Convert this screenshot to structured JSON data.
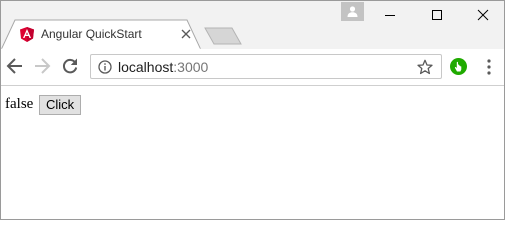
{
  "browser": {
    "tab": {
      "title": "Angular QuickStart",
      "favicon": "angular-icon"
    },
    "address_bar": {
      "host": "localhost",
      "port": ":3000"
    },
    "colors": {
      "tabstrip_bg": "#f2f2f2",
      "angular_red": "#dd0031",
      "extension_green": "#1faa00"
    },
    "icons": [
      "profile-icon",
      "minimize-icon",
      "maximize-icon",
      "close-icon",
      "back-arrow-icon",
      "forward-arrow-icon",
      "reload-icon",
      "info-icon",
      "star-icon",
      "extension-icon",
      "menu-icon"
    ]
  },
  "page": {
    "value_text": "false",
    "button_label": "Click"
  }
}
